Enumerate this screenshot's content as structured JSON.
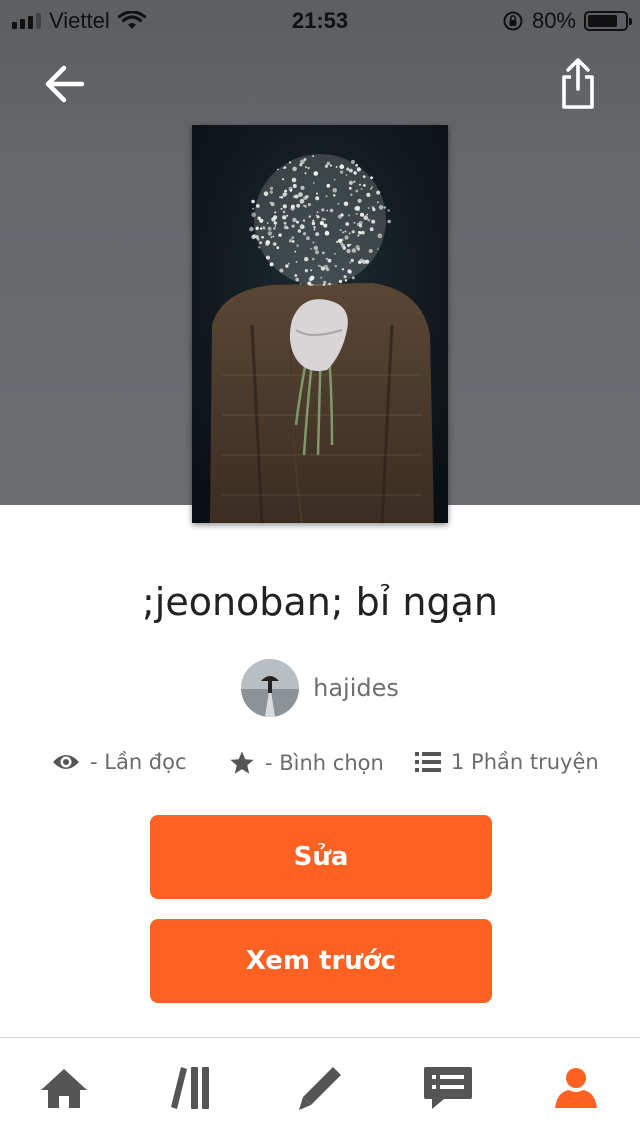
{
  "status_bar": {
    "carrier": "Viettel",
    "time": "21:53",
    "battery": "80%",
    "battery_level": 0.8
  },
  "header": {
    "back_icon": "back-arrow-icon",
    "share_icon": "share-icon"
  },
  "story": {
    "title": ";jeonoban; bỉ ngạn",
    "author": "hajides",
    "stats": {
      "reads": "- Lần đọc",
      "votes": "- Bình chọn",
      "parts": "1 Phần truyện"
    }
  },
  "actions": {
    "edit_label": "Sửa",
    "preview_label": "Xem trước"
  },
  "tabbar": {
    "tabs": [
      {
        "name": "home",
        "icon": "home-icon"
      },
      {
        "name": "library",
        "icon": "library-icon"
      },
      {
        "name": "write",
        "icon": "pencil-icon"
      },
      {
        "name": "messages",
        "icon": "chat-icon"
      },
      {
        "name": "profile",
        "icon": "person-icon",
        "active": true
      }
    ]
  },
  "colors": {
    "accent": "#ff6122",
    "tab_inactive": "#555555",
    "hero_bg": "#63676a"
  }
}
